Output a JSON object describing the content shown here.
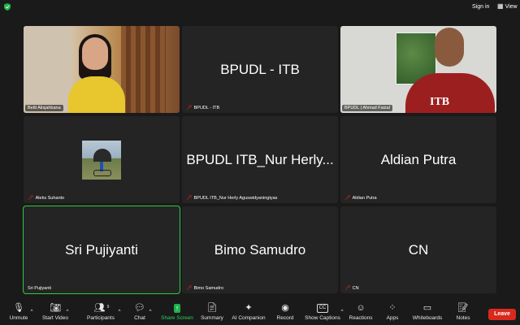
{
  "topbar": {
    "signin_label": "Sign in",
    "view_label": "View"
  },
  "tiles": [
    {
      "name": "Betti Alisjahbana",
      "muted": false,
      "type": "video"
    },
    {
      "name": "BPUDL  - ITB",
      "display_name": "BPUDL  - ITB",
      "muted": true,
      "type": "name"
    },
    {
      "name": "BPUDL | Ahmad Faizal",
      "muted": false,
      "type": "video",
      "shirt_logo": "ITB"
    },
    {
      "name": "Aleks Suhanto",
      "muted": true,
      "type": "avatar"
    },
    {
      "name": "BPUDL ITB_Nur Herly Aguswidyaningtyas",
      "display_name": "BPUDL ITB_Nur Herly...",
      "muted": true,
      "type": "name"
    },
    {
      "name": "Aldian Putra",
      "display_name": "Aldian Putra",
      "muted": true,
      "type": "name"
    },
    {
      "name": "Sri Pujiyanti",
      "display_name": "Sri Pujiyanti",
      "muted": false,
      "type": "name",
      "active_speaker": true
    },
    {
      "name": "Bimo Samudro",
      "display_name": "Bimo Samudro",
      "muted": true,
      "type": "name"
    },
    {
      "name": "CN",
      "display_name": "CN",
      "muted": true,
      "type": "name"
    }
  ],
  "toolbar": {
    "unmute": "Unmute",
    "start_video": "Start Video",
    "participants": "Participants",
    "participants_count": "9",
    "chat": "Chat",
    "share_screen": "Share Screen",
    "summary": "Summary",
    "ai_companion": "AI Companion",
    "record": "Record",
    "show_captions": "Show Captions",
    "captions_icon_text": "CC",
    "reactions": "Reactions",
    "apps": "Apps",
    "whiteboards": "Whiteboards",
    "notes": "Notes",
    "leave": "Leave"
  },
  "colors": {
    "background": "#1a1a1a",
    "tile": "#242424",
    "active_border": "#2ecc40",
    "share_green": "#1fb14c",
    "leave_red": "#d9281c",
    "muted_red": "#e02828"
  }
}
